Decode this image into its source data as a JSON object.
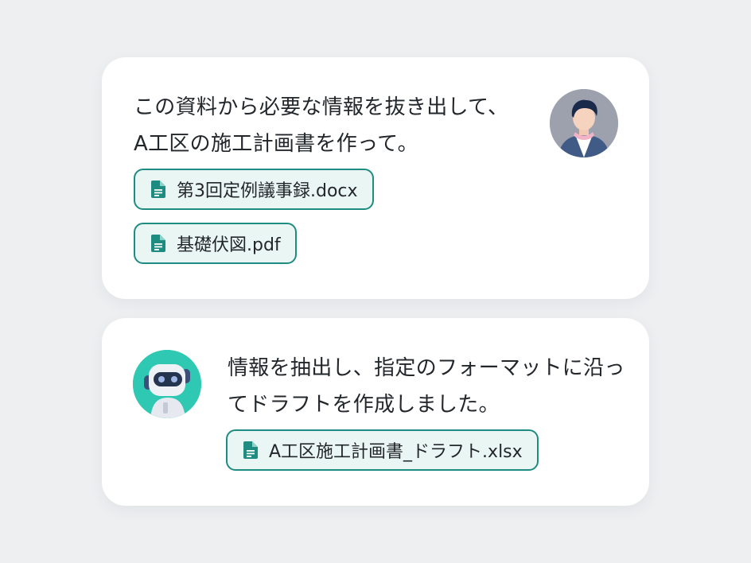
{
  "user_message": {
    "lines": [
      "この資料から必要な情報を抜き出して、",
      "A工区の施工計画書を作って。"
    ],
    "attachments": [
      {
        "name": "第3回定例議事録.docx",
        "icon": "document-icon"
      },
      {
        "name": "基礎伏図.pdf",
        "icon": "document-icon"
      }
    ],
    "avatar": "user-avatar"
  },
  "bot_message": {
    "lines": [
      "情報を抽出し、指定のフォーマットに沿っ",
      "てドラフトを作成しました。"
    ],
    "attachments": [
      {
        "name": "A工区施工計画書_ドラフト.xlsx",
        "icon": "document-icon"
      }
    ],
    "avatar": "robot-avatar"
  },
  "colors": {
    "background": "#eeeff1",
    "card": "#ffffff",
    "accent": "#1e8c80",
    "chip_fill": "#eaf6f4",
    "robot_bg": "#2fc9b3",
    "user_avatar_bg": "#9da1ad"
  }
}
